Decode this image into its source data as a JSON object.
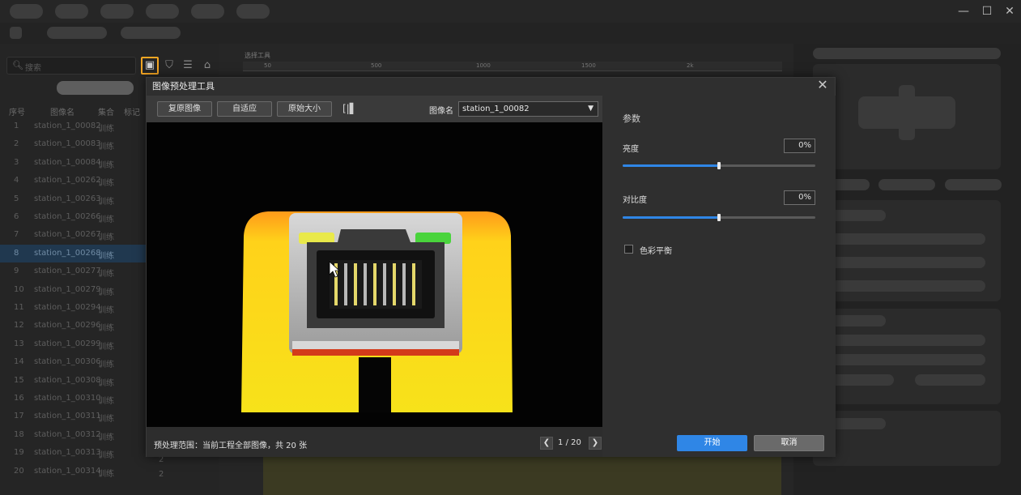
{
  "window": {
    "minimize": "—",
    "maximize": "☐",
    "close": "✕"
  },
  "left_panel": {
    "search_placeholder": "搜索",
    "columns": [
      "序号",
      "图像名",
      "集合",
      "标记"
    ],
    "rows": [
      {
        "idx": "1",
        "name": "station_1_00082",
        "set": "训练"
      },
      {
        "idx": "2",
        "name": "station_1_00083",
        "set": "训练"
      },
      {
        "idx": "3",
        "name": "station_1_00084",
        "set": "训练"
      },
      {
        "idx": "4",
        "name": "station_1_00262",
        "set": "训练"
      },
      {
        "idx": "5",
        "name": "station_1_00263",
        "set": "训练"
      },
      {
        "idx": "6",
        "name": "station_1_00266",
        "set": "训练"
      },
      {
        "idx": "7",
        "name": "station_1_00267",
        "set": "训练"
      },
      {
        "idx": "8",
        "name": "station_1_00268",
        "set": "训练"
      },
      {
        "idx": "9",
        "name": "station_1_00277",
        "set": "训练"
      },
      {
        "idx": "10",
        "name": "station_1_00279",
        "set": "训练"
      },
      {
        "idx": "11",
        "name": "station_1_00294",
        "set": "训练"
      },
      {
        "idx": "12",
        "name": "station_1_00296",
        "set": "训练"
      },
      {
        "idx": "13",
        "name": "station_1_00299",
        "set": "训练"
      },
      {
        "idx": "14",
        "name": "station_1_00306",
        "set": "训练"
      },
      {
        "idx": "15",
        "name": "station_1_00308",
        "set": "训练"
      },
      {
        "idx": "16",
        "name": "station_1_00310",
        "set": "训练"
      },
      {
        "idx": "17",
        "name": "station_1_00311",
        "set": "训练"
      },
      {
        "idx": "18",
        "name": "station_1_00312",
        "set": "训练"
      },
      {
        "idx": "19",
        "name": "station_1_00313",
        "set": "训练"
      },
      {
        "idx": "20",
        "name": "station_1_00314",
        "set": "训练"
      }
    ],
    "selected_index": 7,
    "right_col_marks": [
      "2",
      "2",
      "2",
      "2"
    ]
  },
  "canvas": {
    "ruler_label": "选择工具",
    "ruler_ticks": [
      "50",
      "500",
      "1000",
      "1500",
      "2k"
    ]
  },
  "modal": {
    "title": "图像预处理工具",
    "toolbar": {
      "restore": "复原图像",
      "fit": "自适应",
      "original_size": "原始大小",
      "image_name_label": "图像名",
      "image_name_value": "station_1_00082"
    },
    "footer": {
      "scope_text": "预处理范围：当前工程全部图像，共 20 张",
      "page_current": "1",
      "page_sep": "/",
      "page_total": "20"
    },
    "params": {
      "title": "参数",
      "brightness_label": "亮度",
      "brightness_value": "0%",
      "brightness_level": 0.5,
      "contrast_label": "对比度",
      "contrast_value": "0%",
      "contrast_level": 0.5,
      "color_balance_label": "色彩平衡",
      "color_balance_checked": false
    },
    "buttons": {
      "start": "开始",
      "cancel": "取消"
    }
  },
  "colors": {
    "accent": "#2f86e6",
    "highlight_icon_border": "#f5a623",
    "housing_yellow": "#f7e21a",
    "led_yellow": "#e9e94a",
    "led_green": "#49d43c"
  }
}
